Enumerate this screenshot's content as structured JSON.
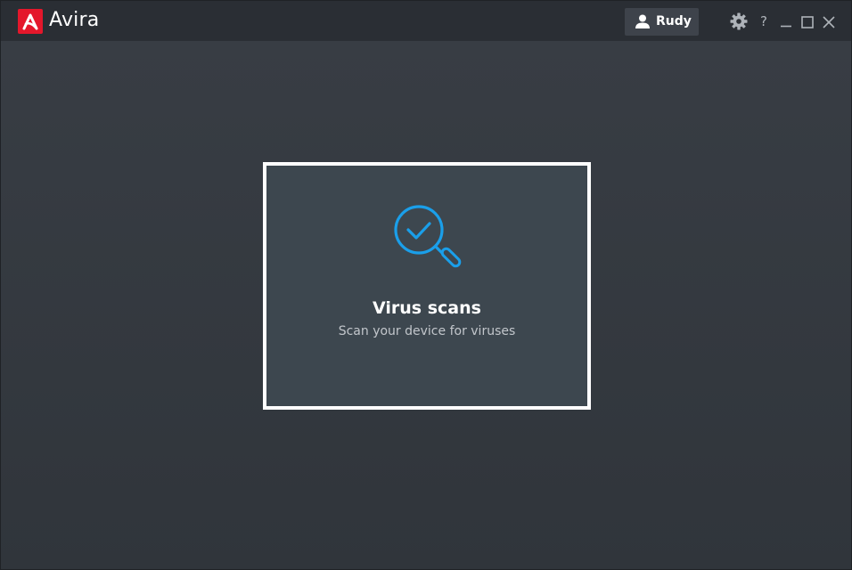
{
  "app": {
    "title": "Avira",
    "logo_icon": "avira-logo-icon",
    "brand_color": "#e4172b"
  },
  "titlebar": {
    "user": {
      "name": "Rudy",
      "icon": "user-icon"
    },
    "settings_icon": "gear-icon",
    "help_label": "?",
    "minimize_icon": "minimize-icon",
    "maximize_icon": "maximize-icon",
    "close_icon": "close-icon"
  },
  "main": {
    "card": {
      "title": "Virus scans",
      "subtitle": "Scan your device for viruses",
      "icon": "virus-scan-magnifier-check-icon",
      "accent_color": "#1a9fea"
    }
  }
}
